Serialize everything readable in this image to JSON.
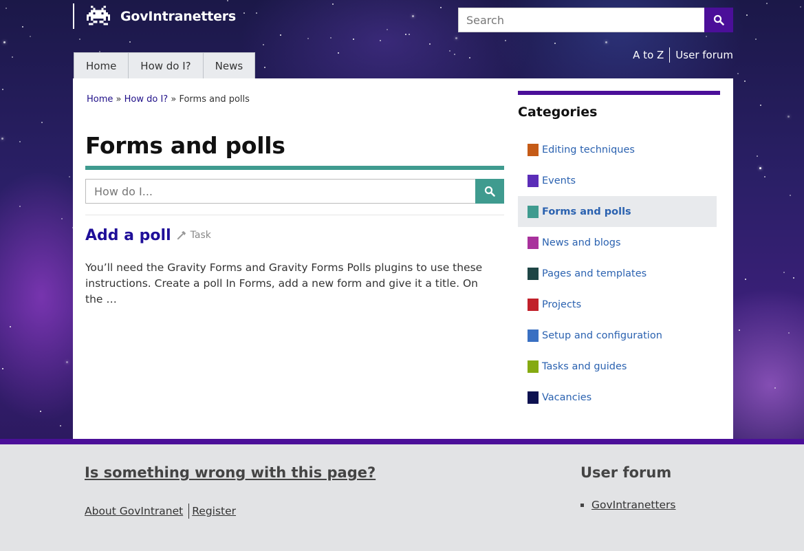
{
  "site": {
    "name": "GovIntranetters"
  },
  "search": {
    "placeholder": "Search"
  },
  "utility_links": [
    "A to Z",
    "User forum"
  ],
  "nav": {
    "tabs": [
      "Home",
      "How do I?",
      "News"
    ]
  },
  "breadcrumb": {
    "home": "Home",
    "sep1": "»",
    "howdoi": "How do I?",
    "sep2": "»",
    "current": "Forms and polls"
  },
  "page": {
    "title": "Forms and polls",
    "howdoi_placeholder": "How do I..."
  },
  "result": {
    "title": "Add a poll",
    "type": "Task",
    "excerpt": "You’ll need the Gravity Forms and Gravity Forms Polls plugins to use these instructions. Create a poll In Forms, add a new form and give it a title. On the …"
  },
  "categories": {
    "heading": "Categories",
    "items": [
      {
        "label": "Editing techniques",
        "color": "#c55b17"
      },
      {
        "label": "Events",
        "color": "#5b2db8"
      },
      {
        "label": "Forms and polls",
        "color": "#3f9b8f"
      },
      {
        "label": "News and blogs",
        "color": "#a8319c"
      },
      {
        "label": "Pages and templates",
        "color": "#1e4545"
      },
      {
        "label": "Projects",
        "color": "#c1202a"
      },
      {
        "label": "Setup and configuration",
        "color": "#3a70c2"
      },
      {
        "label": "Tasks and guides",
        "color": "#85aa11"
      },
      {
        "label": "Vacancies",
        "color": "#0d1150"
      }
    ],
    "active_index": 2
  },
  "footer": {
    "feedback_link": "Is something wrong with this page?",
    "about_link": "About GovIntranet",
    "register_link": "Register",
    "forum_heading": "User forum",
    "forum_links": [
      "GovIntranetters"
    ]
  },
  "colors": {
    "brand_purple": "#4b0f99",
    "accent_teal": "#3f9b8f",
    "link_blue": "#1f0f99"
  }
}
